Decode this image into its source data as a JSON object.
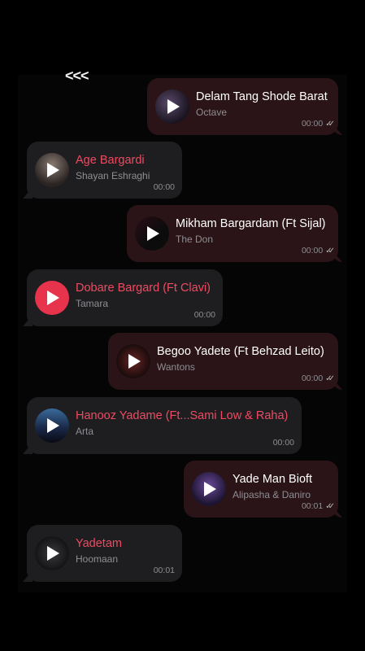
{
  "header": {
    "back_label": "<<<"
  },
  "messages": [
    {
      "title": "Delam Tang Shode Barat",
      "artist": "Octave",
      "time": "00:00",
      "direction": "out",
      "read": true,
      "thumb": "cover-dark-purple"
    },
    {
      "title": "Age Bargardi",
      "artist": "Shayan Eshraghi",
      "time": "00:00",
      "direction": "in",
      "read": false,
      "thumb": "cover-portrait"
    },
    {
      "title": "Mikham Bargardam (Ft Sijal)",
      "artist": "The Don",
      "time": "00:00",
      "direction": "out",
      "read": true,
      "thumb": "cover-black-pink"
    },
    {
      "title": "Dobare Bargard (Ft Clavi)",
      "artist": "Tamara",
      "time": "00:00",
      "direction": "in",
      "read": false,
      "thumb": "red-circle"
    },
    {
      "title": "Begoo Yadete (Ft Behzad Leito)",
      "artist": "Wantons",
      "time": "00:00",
      "direction": "out",
      "read": true,
      "thumb": "cover-red-shades"
    },
    {
      "title": "Hanooz Yadame (Ft...Sami Low & Raha)",
      "artist": "Arta",
      "time": "00:00",
      "direction": "in",
      "read": false,
      "thumb": "cover-blue-sky"
    },
    {
      "title": "Yade Man Bioft",
      "artist": "Alipasha & Daniro",
      "time": "00:01",
      "direction": "out",
      "read": true,
      "thumb": "cover-purple"
    },
    {
      "title": "Yadetam",
      "artist": "Hoomaan",
      "time": "00:01",
      "direction": "in",
      "read": false,
      "thumb": "cover-dark"
    }
  ],
  "colors": {
    "outgoing_bubble": "#2a1417",
    "incoming_bubble": "#1e1e20",
    "incoming_title": "#f04a62",
    "play_button_red": "#e8334d"
  },
  "read_receipt_icon": "double-check-icon",
  "play_icon": "play-icon"
}
